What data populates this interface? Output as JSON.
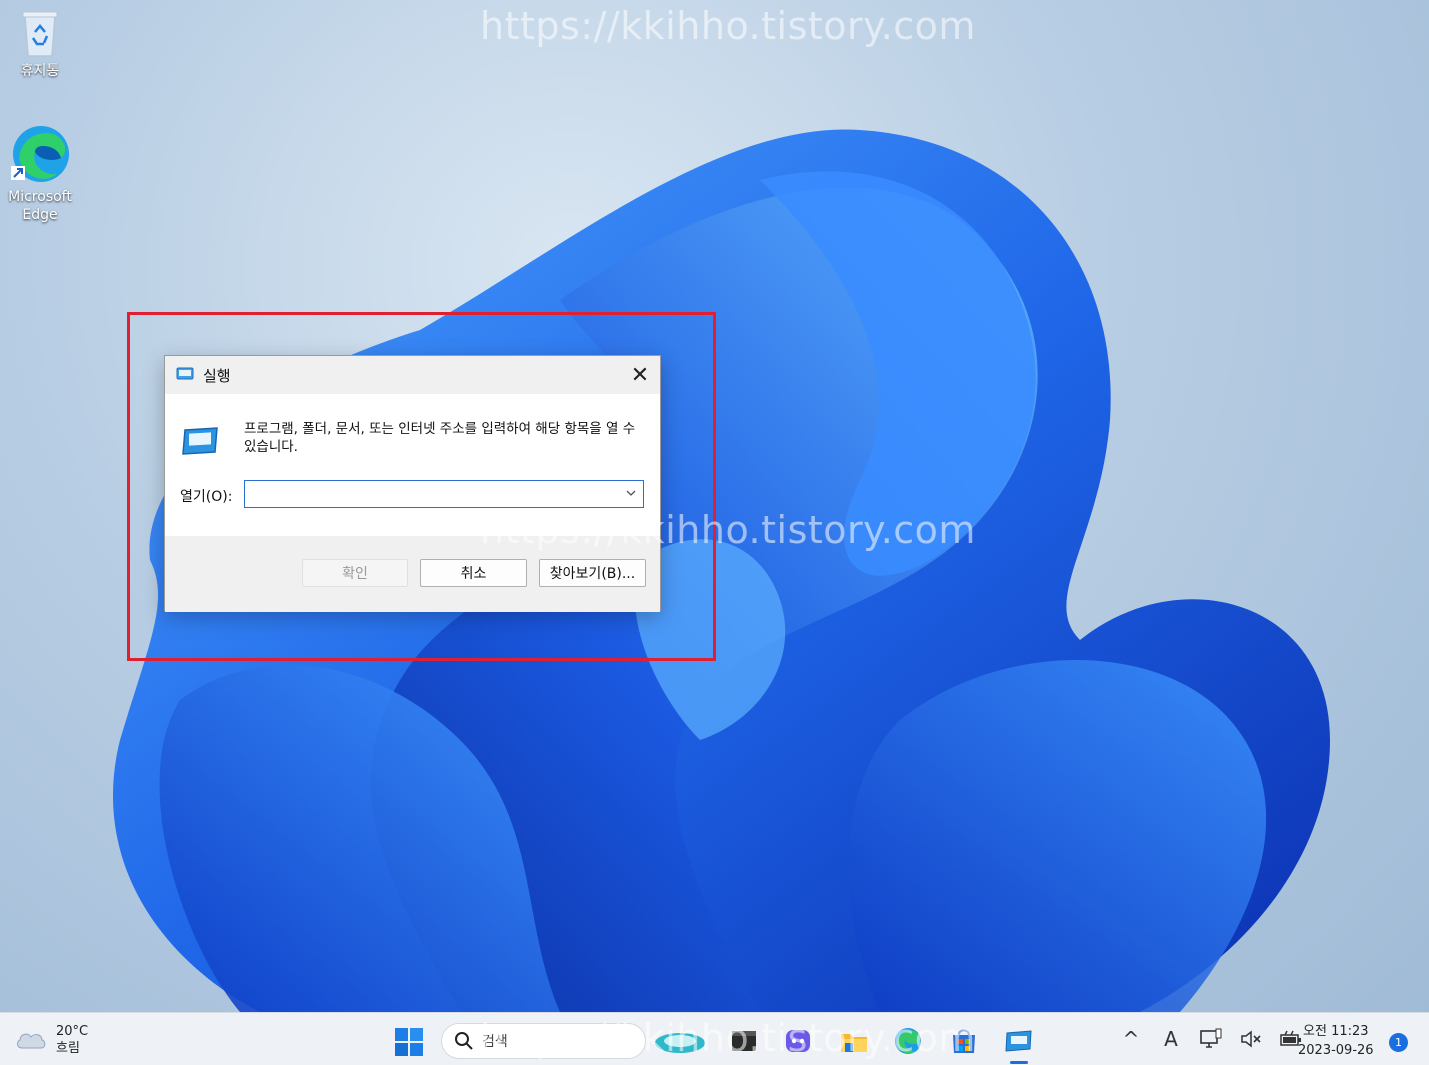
{
  "watermark": "https://kkihho.tistory.com",
  "desktop": {
    "icons": [
      {
        "label": "휴지통",
        "icon": "recycle-bin-icon"
      },
      {
        "label": "Microsoft Edge",
        "icon": "edge-icon"
      }
    ]
  },
  "run_dialog": {
    "title": "실행",
    "close_label": "✕",
    "description": "프로그램, 폴더, 문서, 또는 인터넷 주소를 입력하여 해당 항목을 열 수 있습니다.",
    "open_label": "열기(O):",
    "open_value": "",
    "buttons": {
      "ok": "확인",
      "cancel": "취소",
      "browse": "찾아보기(B)..."
    }
  },
  "taskbar": {
    "weather": {
      "temp": "20°C",
      "condition": "흐림"
    },
    "search_placeholder": "검색",
    "apps": [
      "copilot-icon",
      "terminal-icon",
      "discord-icon",
      "file-explorer-icon",
      "edge-icon",
      "store-icon",
      "run-icon"
    ],
    "tray": {
      "chevron": "^",
      "ime": "A"
    },
    "clock": {
      "time": "오전 11:23",
      "date": "2023-09-26"
    },
    "notification_count": "1"
  },
  "colors": {
    "highlight": "#e02030",
    "accent": "#1a6fe0"
  }
}
